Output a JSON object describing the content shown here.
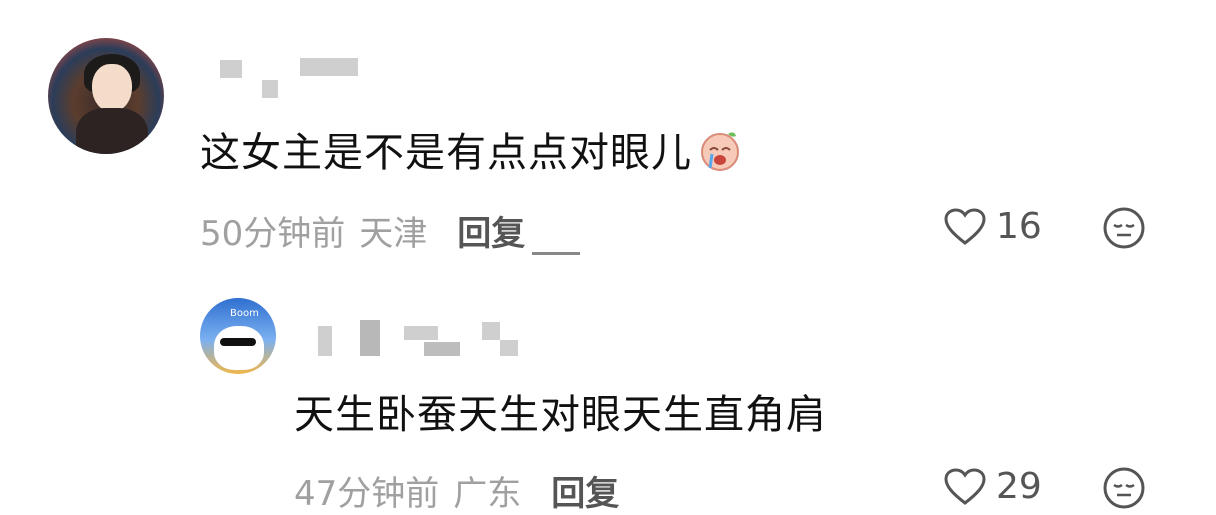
{
  "comments": [
    {
      "text": "这女主是不是有点点对眼儿",
      "time": "50分钟前",
      "location": "天津",
      "reply_label": "回复",
      "likes": "16",
      "reaction_icon": "neutral-face-icon",
      "emoji": "crying-baby-emoji"
    },
    {
      "text": "天生卧蚕天生对眼天生直角肩",
      "time": "47分钟前",
      "location": "广东",
      "reply_label": "回复",
      "likes": "29",
      "reaction_icon": "neutral-face-icon"
    }
  ],
  "avatar_badge_text": "Boom",
  "colors": {
    "meta_gray": "#a0a0a0",
    "text_black": "#111111",
    "icon_gray": "#555555"
  }
}
